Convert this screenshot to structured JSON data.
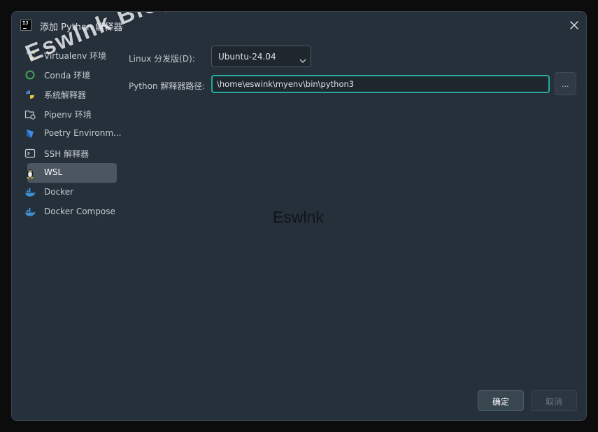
{
  "window": {
    "title": "添加 Python 解释器"
  },
  "sidebar": {
    "items": [
      {
        "label": "Virtualenv 环境",
        "icon": "virtualenv-icon"
      },
      {
        "label": "Conda 环境",
        "icon": "conda-icon"
      },
      {
        "label": "系统解释器",
        "icon": "python-icon"
      },
      {
        "label": "Pipenv 环境",
        "icon": "pipenv-icon"
      },
      {
        "label": "Poetry Environm...",
        "icon": "poetry-icon"
      },
      {
        "label": "SSH 解释器",
        "icon": "terminal-icon"
      },
      {
        "label": "WSL",
        "icon": "linux-penguin-icon",
        "selected": true
      },
      {
        "label": "Docker",
        "icon": "docker-icon"
      },
      {
        "label": "Docker Compose",
        "icon": "docker-compose-icon"
      }
    ]
  },
  "form": {
    "distro_label": "Linux 分发版(D):",
    "distro_value": "Ubuntu-24.04",
    "path_label": "Python 解释器路径:",
    "path_value": "\\home\\eswink\\myenv\\bin\\python3",
    "browse_label": "..."
  },
  "buttons": {
    "ok": "确定",
    "cancel": "取消"
  },
  "watermarks": {
    "diagonal": "Eswlnk  Blog",
    "center": "Eswlnk"
  },
  "colors": {
    "dialog_bg": "#25303a",
    "accent_focus": "#2aa8a0",
    "selected_bg": "#4b5660"
  }
}
